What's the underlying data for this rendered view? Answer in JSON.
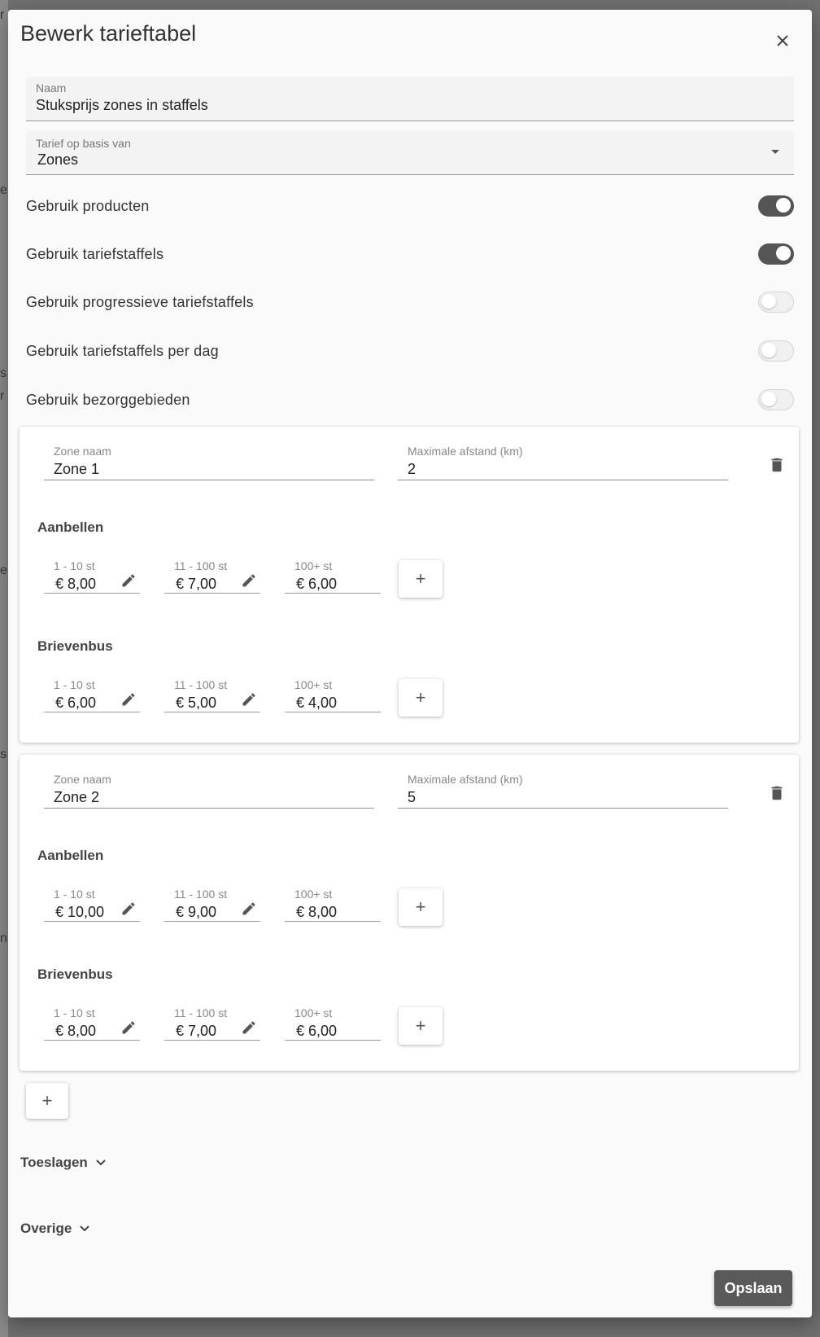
{
  "background": {
    "edge_letters": [
      "r",
      "e",
      "s",
      "r",
      "e",
      "s",
      "n"
    ]
  },
  "dialog": {
    "title": "Bewerk tarieftabel",
    "close_icon": "close-icon"
  },
  "fields": {
    "naam": {
      "label": "Naam",
      "value": "Stuksprijs zones in staffels"
    },
    "tarief_basis": {
      "label": "Tarief op basis van",
      "value": "Zones"
    }
  },
  "toggles": [
    {
      "label": "Gebruik producten",
      "on": true
    },
    {
      "label": "Gebruik tariefstaffels",
      "on": true
    },
    {
      "label": "Gebruik progressieve tariefstaffels",
      "on": false
    },
    {
      "label": "Gebruik tariefstaffels per dag",
      "on": false
    },
    {
      "label": "Gebruik bezorggebieden",
      "on": false
    }
  ],
  "zones": [
    {
      "name_label": "Zone naam",
      "name": "Zone 1",
      "distance_label": "Maximale afstand (km)",
      "distance": "2",
      "groups": [
        {
          "title": "Aanbellen",
          "tiers": [
            {
              "label": "1 - 10 st",
              "value": "€ 8,00"
            },
            {
              "label": "11 - 100 st",
              "value": "€ 7,00"
            },
            {
              "label": "100+ st",
              "value": "€ 6,00"
            }
          ]
        },
        {
          "title": "Brievenbus",
          "tiers": [
            {
              "label": "1 - 10 st",
              "value": "€ 6,00"
            },
            {
              "label": "11 - 100 st",
              "value": "€ 5,00"
            },
            {
              "label": "100+ st",
              "value": "€ 4,00"
            }
          ]
        }
      ]
    },
    {
      "name_label": "Zone naam",
      "name": "Zone 2",
      "distance_label": "Maximale afstand (km)",
      "distance": "5",
      "groups": [
        {
          "title": "Aanbellen",
          "tiers": [
            {
              "label": "1 - 10 st",
              "value": "€ 10,00"
            },
            {
              "label": "11 - 100 st",
              "value": "€ 9,00"
            },
            {
              "label": "100+ st",
              "value": "€ 8,00"
            }
          ]
        },
        {
          "title": "Brievenbus",
          "tiers": [
            {
              "label": "1 - 10 st",
              "value": "€ 8,00"
            },
            {
              "label": "11 - 100 st",
              "value": "€ 7,00"
            },
            {
              "label": "100+ st",
              "value": "€ 6,00"
            }
          ]
        }
      ]
    }
  ],
  "add_symbol": "+",
  "expanders": {
    "toeslagen": "Toeslagen",
    "overige": "Overige"
  },
  "save_label": "Opslaan",
  "colors": {
    "switch_on": "#555555",
    "switch_off": "#f0f0f0",
    "save_button": "#5a5a5a"
  }
}
